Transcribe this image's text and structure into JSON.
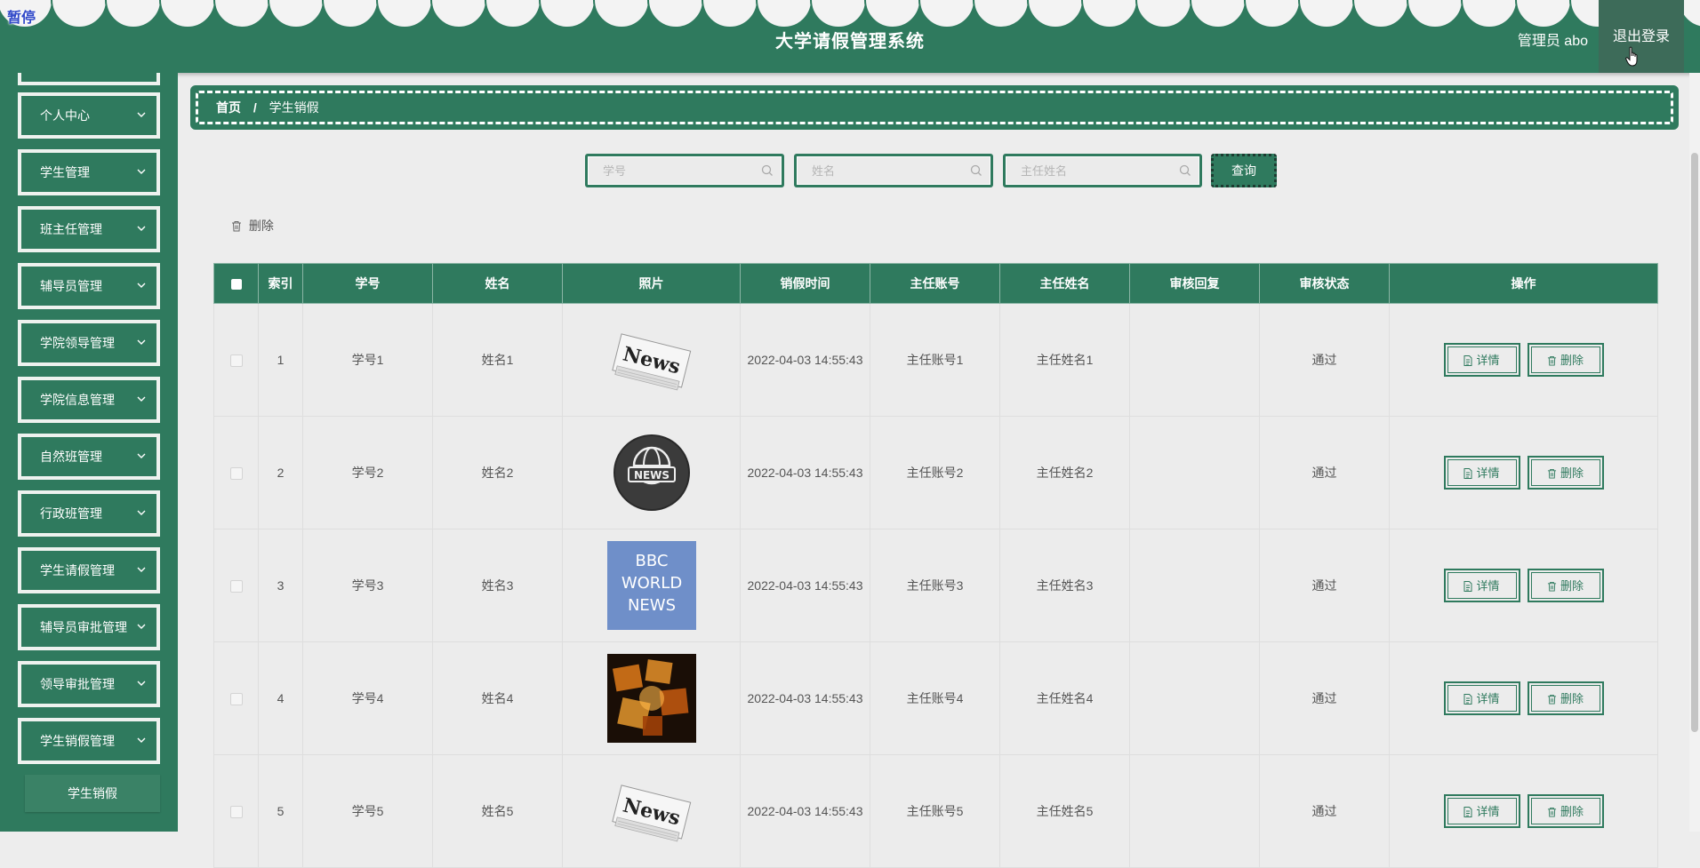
{
  "header": {
    "pause_badge": "暂停",
    "title": "大学请假管理系统",
    "user_info": "管理员 abo",
    "logout_label": "退出登录"
  },
  "sidebar": {
    "items": [
      {
        "label": "个人中心"
      },
      {
        "label": "学生管理"
      },
      {
        "label": "班主任管理"
      },
      {
        "label": "辅导员管理"
      },
      {
        "label": "学院领导管理"
      },
      {
        "label": "学院信息管理"
      },
      {
        "label": "自然班管理"
      },
      {
        "label": "行政班管理"
      },
      {
        "label": "学生请假管理"
      },
      {
        "label": "辅导员审批管理"
      },
      {
        "label": "领导审批管理"
      },
      {
        "label": "学生销假管理"
      }
    ],
    "active_sub_item": "学生销假"
  },
  "breadcrumb": {
    "home": "首页",
    "separator": "/",
    "current": "学生销假"
  },
  "search": {
    "student_no_placeholder": "学号",
    "name_placeholder": "姓名",
    "head_teacher_name_placeholder": "主任姓名",
    "query_label": "查询"
  },
  "toolbar": {
    "delete_label": "删除"
  },
  "table": {
    "columns": [
      "索引",
      "学号",
      "姓名",
      "照片",
      "销假时间",
      "主任账号",
      "主任姓名",
      "审核回复",
      "审核状态",
      "操作"
    ],
    "rows": [
      {
        "index": "1",
        "student_no": "学号1",
        "name": "姓名1",
        "photo": "news-paper",
        "photo_text": "News",
        "time": "2022-04-03 14:55:43",
        "head_account": "主任账号1",
        "head_name": "主任姓名1",
        "reply": "",
        "status": "通过"
      },
      {
        "index": "2",
        "student_no": "学号2",
        "name": "姓名2",
        "photo": "news-globe",
        "photo_text": "NEWS",
        "time": "2022-04-03 14:55:43",
        "head_account": "主任账号2",
        "head_name": "主任姓名2",
        "reply": "",
        "status": "通过"
      },
      {
        "index": "3",
        "student_no": "学号3",
        "name": "姓名3",
        "photo": "bbc-world-news",
        "photo_text": "BBC WORLD NEWS",
        "time": "2022-04-03 14:55:43",
        "head_account": "主任账号3",
        "head_name": "主任姓名3",
        "reply": "",
        "status": "通过"
      },
      {
        "index": "4",
        "student_no": "学号4",
        "name": "姓名4",
        "photo": "money-letters",
        "photo_text": "",
        "time": "2022-04-03 14:55:43",
        "head_account": "主任账号4",
        "head_name": "主任姓名4",
        "reply": "",
        "status": "通过"
      },
      {
        "index": "5",
        "student_no": "学号5",
        "name": "姓名5",
        "photo": "news-paper",
        "photo_text": "News",
        "time": "2022-04-03 14:55:43",
        "head_account": "主任账号5",
        "head_name": "主任姓名5",
        "reply": "",
        "status": "通过"
      }
    ],
    "detail_label": "详情",
    "delete_label": "删除"
  },
  "colors": {
    "primary": "#2f7a5e",
    "background": "#ededed"
  }
}
